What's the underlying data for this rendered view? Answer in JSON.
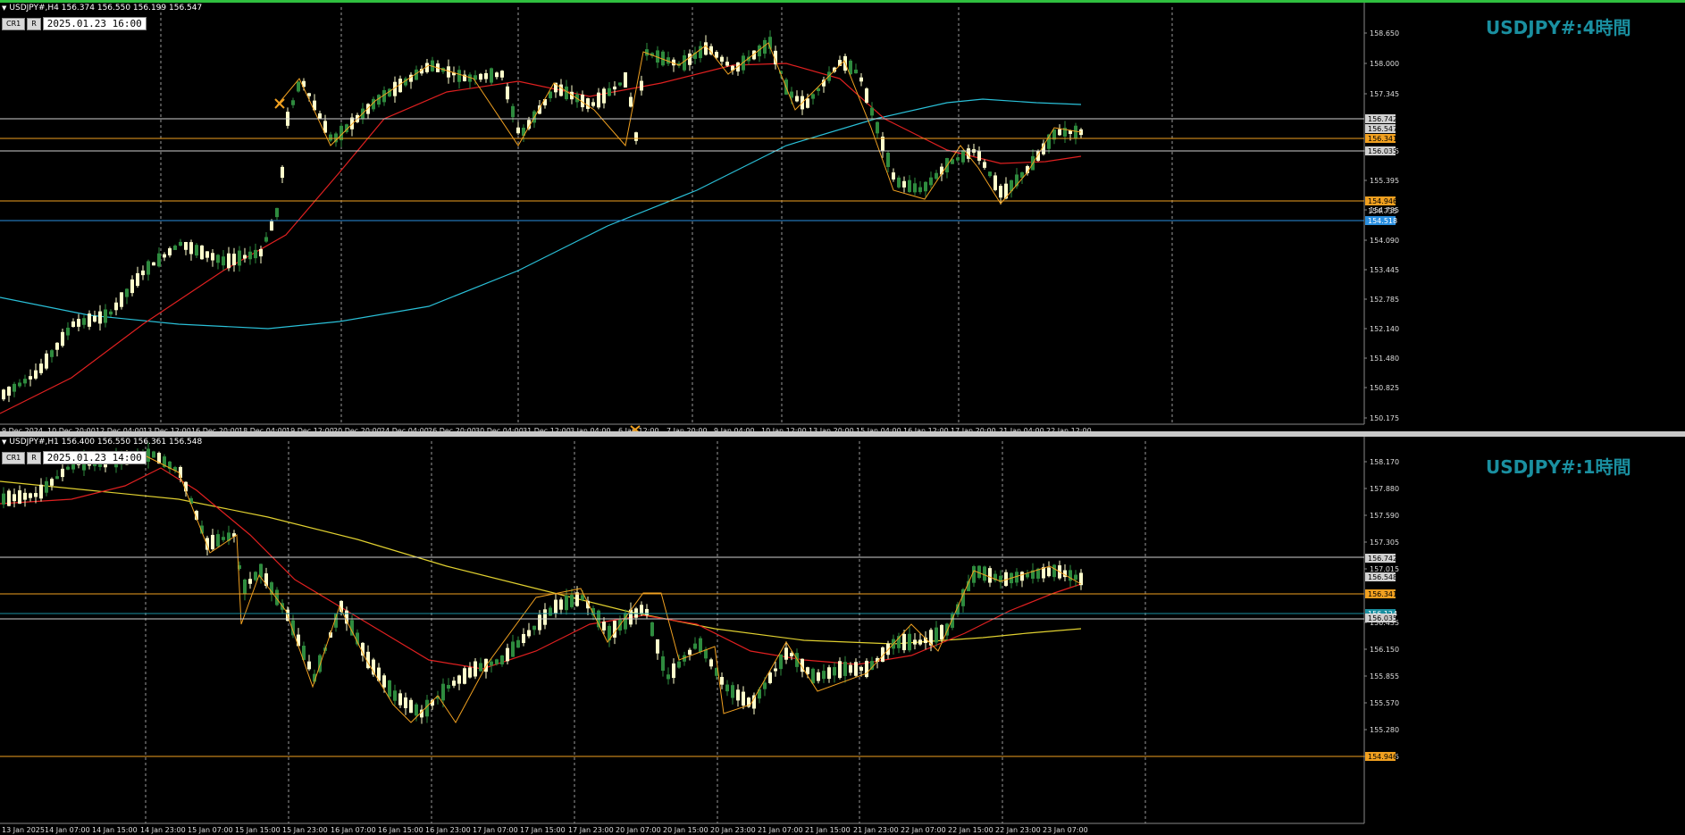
{
  "colors": {
    "background": "#000000",
    "grid": "#9a9a9a",
    "bull_candle": "#2e8b3e",
    "bear_candle": "#ffffcc",
    "zigzag": "#f0a020",
    "ma_short": "#e02020",
    "ma_long_h4": "#2ac0d8",
    "ma_long_h1": "#e0d030",
    "level_white": "#d0d0d0",
    "level_orange": "#f0a020",
    "level_blue": "#2a8fe0",
    "watermark": "#1a8fa0",
    "top_border": "#2fbf3f"
  },
  "h4": {
    "header": "USDJPY#,H4  156.374 156.550 156.199 156.547",
    "btn_cr": "CR1",
    "btn_r": "R",
    "date": "2025.01.23  16:00",
    "watermark": "USDJPY#:4時間",
    "price_ticks": [
      "158.650",
      "158.000",
      "157.345",
      "156.035",
      "155.395",
      "154.735",
      "154.090",
      "153.445",
      "152.785",
      "152.140",
      "151.480",
      "150.825",
      "150.175"
    ],
    "time_ticks": [
      "9 Dec 2024",
      "10 Dec 20:00",
      "12 Dec 04:00",
      "13 Dec 12:00",
      "16 Dec 20:00",
      "18 Dec 04:00",
      "19 Dec 12:00",
      "20 Dec 20:00",
      "24 Dec 04:00",
      "26 Dec 20:00",
      "30 Dec 04:00",
      "31 Dec 12:00",
      "3 Jan 04:00",
      "6 Jan 12:00",
      "7 Jan 20:00",
      "9 Jan 04:00",
      "10 Jan 12:00",
      "13 Jan 20:00",
      "15 Jan 04:00",
      "16 Jan 12:00",
      "17 Jan 20:00",
      "21 Jan 04:00",
      "22 Jan 12:00"
    ],
    "level_labels": [
      {
        "text": "156.742",
        "color": "white"
      },
      {
        "text": "156.547",
        "color": "white"
      },
      {
        "text": "156.341",
        "color": "orange"
      },
      {
        "text": "156.035",
        "color": "white"
      },
      {
        "text": "154.946",
        "color": "orange"
      },
      {
        "text": "154.735",
        "color": "plain"
      },
      {
        "text": "154.518",
        "color": "blue"
      }
    ]
  },
  "h1": {
    "header": "USDJPY#,H1  156.400 156.550 156.361 156.548",
    "btn_cr": "CR1",
    "btn_r": "R",
    "date": "2025.01.23  14:00",
    "watermark": "USDJPY#:1時間",
    "price_ticks": [
      "158.170",
      "157.880",
      "157.590",
      "157.305",
      "157.015",
      "156.435",
      "156.150",
      "155.855",
      "155.570",
      "155.280",
      "154.995"
    ],
    "time_ticks": [
      "13 Jan 2025",
      "14 Jan 07:00",
      "14 Jan 15:00",
      "14 Jan 23:00",
      "15 Jan 07:00",
      "15 Jan 15:00",
      "15 Jan 23:00",
      "16 Jan 07:00",
      "16 Jan 15:00",
      "16 Jan 23:00",
      "17 Jan 07:00",
      "17 Jan 15:00",
      "17 Jan 23:00",
      "20 Jan 07:00",
      "20 Jan 15:00",
      "20 Jan 23:00",
      "21 Jan 07:00",
      "21 Jan 15:00",
      "21 Jan 23:00",
      "22 Jan 07:00",
      "22 Jan 15:00",
      "22 Jan 23:00",
      "23 Jan 07:00"
    ],
    "level_labels": [
      {
        "text": "156.742",
        "color": "white"
      },
      {
        "text": "156.548",
        "color": "white"
      },
      {
        "text": "156.341",
        "color": "orange"
      },
      {
        "text": "156.124",
        "color": "teal"
      },
      {
        "text": "156.035",
        "color": "white"
      },
      {
        "text": "154.946",
        "color": "orange"
      }
    ]
  }
}
